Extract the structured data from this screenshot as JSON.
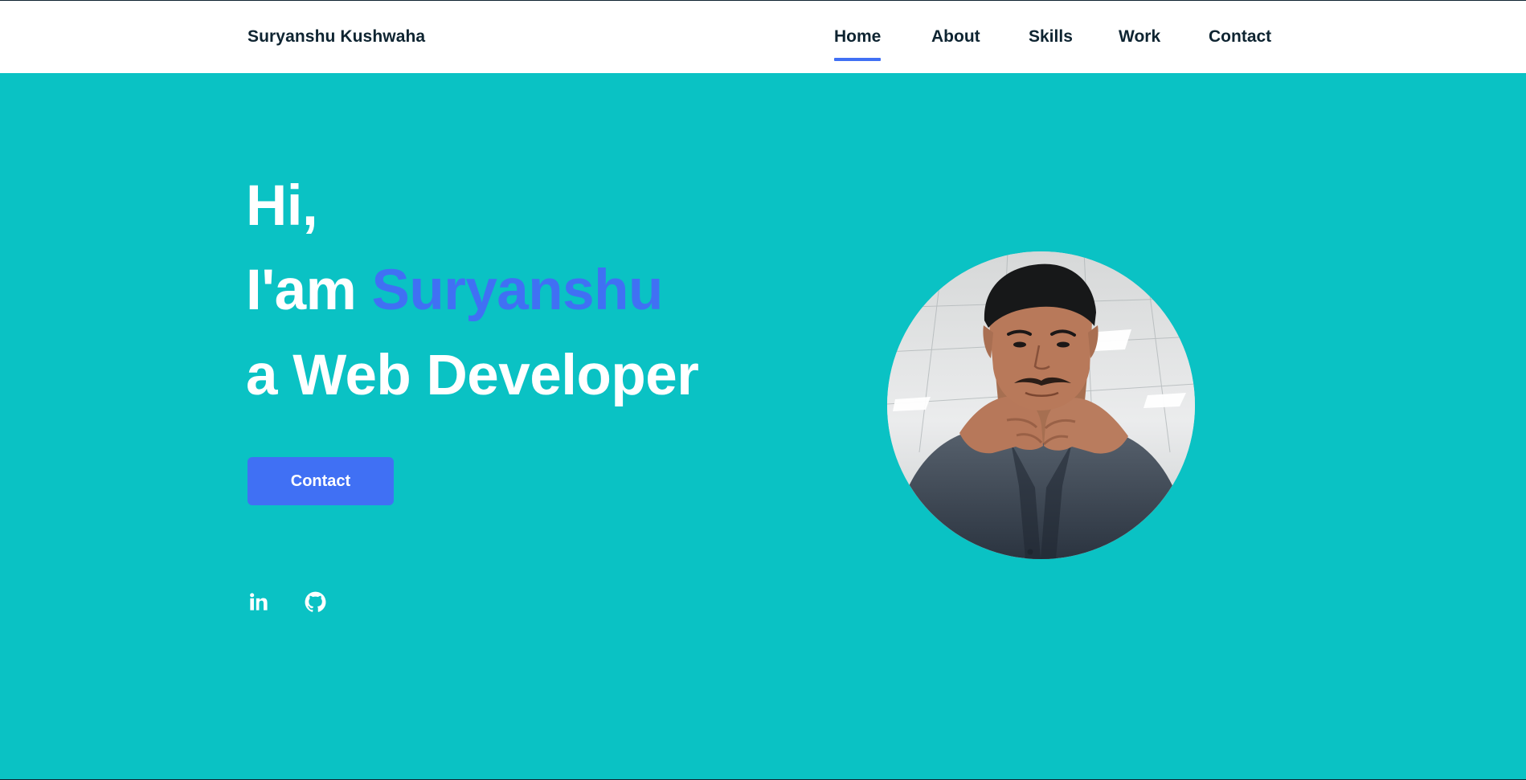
{
  "header": {
    "brand": "Suryanshu Kushwaha",
    "nav": [
      {
        "label": "Home",
        "active": true
      },
      {
        "label": "About",
        "active": false
      },
      {
        "label": "Skills",
        "active": false
      },
      {
        "label": "Work",
        "active": false
      },
      {
        "label": "Contact",
        "active": false
      }
    ]
  },
  "hero": {
    "greeting": "Hi,",
    "intro_prefix": "I'am",
    "name": "Suryanshu",
    "role": "a Web Developer",
    "cta_label": "Contact",
    "social_icons": [
      "linkedin-icon",
      "github-icon"
    ]
  },
  "colors": {
    "background": "#0ac2c4",
    "header": "#ffffff",
    "accent": "#4070f4",
    "dark_text": "#0e2431",
    "light_text": "#ffffff"
  }
}
